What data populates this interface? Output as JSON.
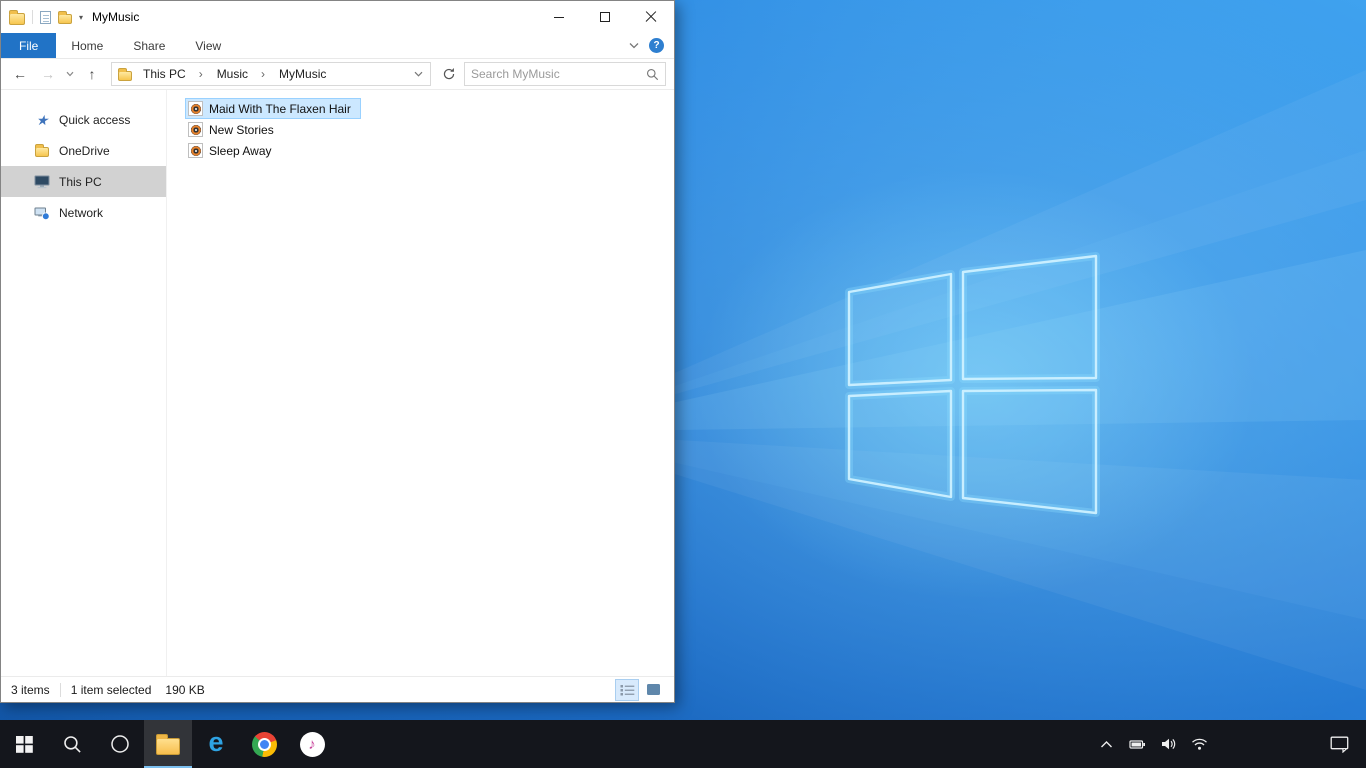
{
  "window": {
    "title": "MyMusic",
    "quick_access_toolbar": {
      "icons": [
        "explorer-window-icon",
        "properties-icon",
        "new-folder-icon",
        "customize-quick-access-icon"
      ],
      "customize_glyph": "▾"
    },
    "caption_buttons": {
      "minimize": "minimize",
      "maximize": "maximize",
      "close": "close"
    },
    "ribbon": {
      "tabs": [
        {
          "label": "File",
          "active": true
        },
        {
          "label": "Home",
          "active": false
        },
        {
          "label": "Share",
          "active": false
        },
        {
          "label": "View",
          "active": false
        }
      ],
      "collapse_ribbon_icon": "chevron-down-icon",
      "help_label": "?"
    },
    "navigation": {
      "back_glyph": "←",
      "forward_glyph": "→",
      "up_glyph": "↑",
      "recent_locations_icon": "chevron-down-icon",
      "refresh_icon": "refresh-icon"
    },
    "address_bar": {
      "breadcrumb": [
        {
          "label": "This PC"
        },
        {
          "label": "Music"
        },
        {
          "label": "MyMusic"
        }
      ],
      "separator": "›",
      "dropdown_icon": "chevron-down-icon"
    },
    "search_box": {
      "placeholder": "Search MyMusic",
      "icon": "search-icon"
    },
    "sidebar": {
      "items": [
        {
          "label": "Quick access",
          "icon": "quick-access-star-icon",
          "selected": false
        },
        {
          "label": "OneDrive",
          "icon": "onedrive-folder-icon",
          "selected": false
        },
        {
          "label": "This PC",
          "icon": "this-pc-icon",
          "selected": true
        },
        {
          "label": "Network",
          "icon": "network-icon",
          "selected": false
        }
      ]
    },
    "file_list": {
      "items": [
        {
          "name": "Maid With The Flaxen Hair",
          "icon": "audio-file-icon",
          "selected": true
        },
        {
          "name": "New Stories",
          "icon": "audio-file-icon",
          "selected": false
        },
        {
          "name": "Sleep Away",
          "icon": "audio-file-icon",
          "selected": false
        }
      ]
    },
    "status_bar": {
      "item_count": "3 items",
      "selection_info": "1 item selected",
      "selection_size": "190 KB",
      "view_buttons": [
        {
          "name": "details-view"
        },
        {
          "name": "large-thumbnails-view"
        }
      ]
    }
  },
  "taskbar": {
    "buttons": [
      {
        "name": "start",
        "icon": "windows-logo-icon"
      },
      {
        "name": "search",
        "icon": "search-icon"
      },
      {
        "name": "cortana",
        "icon": "cortana-circle-icon"
      },
      {
        "name": "file-explorer",
        "icon": "folder-icon",
        "active": true
      },
      {
        "name": "edge",
        "icon": "edge-e-icon",
        "glyph": "e"
      },
      {
        "name": "chrome",
        "icon": "chrome-icon"
      },
      {
        "name": "itunes",
        "icon": "music-note-icon",
        "glyph": "♪"
      }
    ],
    "tray": [
      {
        "name": "hidden-icons",
        "icon": "chevron-up-icon"
      },
      {
        "name": "battery",
        "icon": "battery-icon"
      },
      {
        "name": "volume",
        "icon": "speaker-icon"
      },
      {
        "name": "network",
        "icon": "wifi-icon"
      }
    ],
    "action_center": {
      "name": "action-center",
      "icon": "chat-bubble-icon"
    }
  },
  "colors": {
    "accent": "#0078d7",
    "file_tab_blue": "#2173c6",
    "selection_bg": "#cce8ff",
    "selection_border": "#99d1ff",
    "sidebar_selected": "#d2d2d2",
    "taskbar_bg": "#14161c",
    "wallpaper_base": "#1e78d2"
  }
}
